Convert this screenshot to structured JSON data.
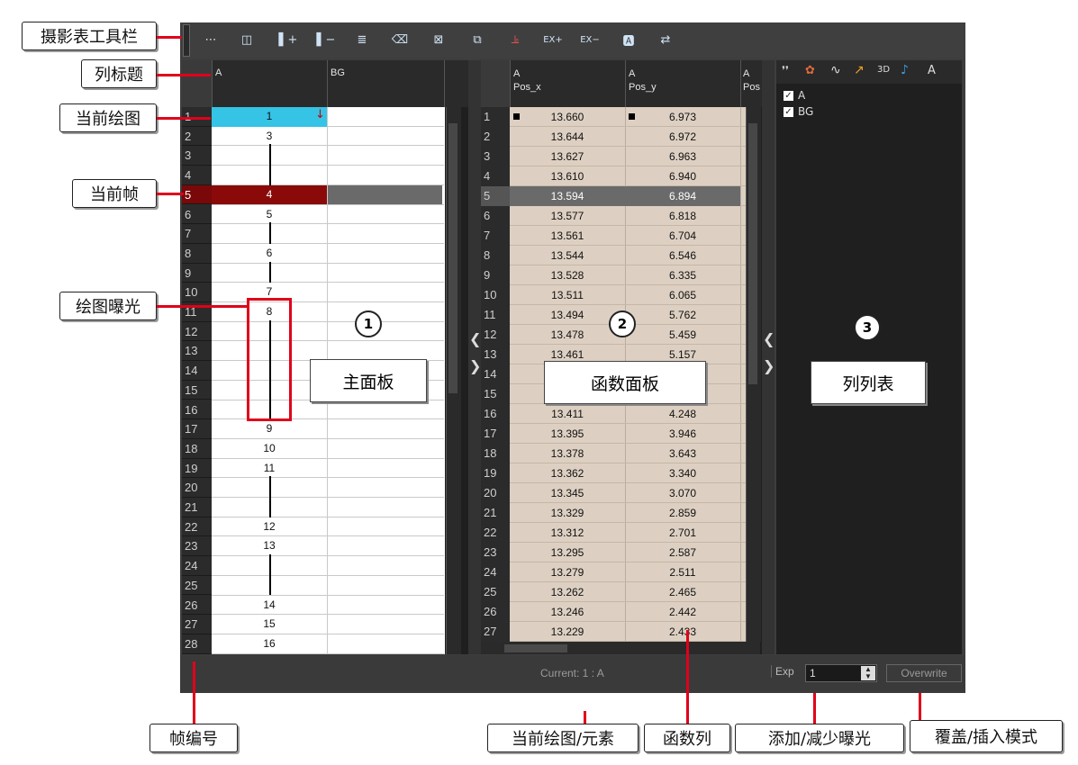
{
  "callouts": {
    "toolbar": "摄影表工具栏",
    "column_header": "列标题",
    "current_drawing": "当前绘图",
    "current_frame": "当前帧",
    "drawing_exposure": "绘图曝光",
    "frame_number": "帧编号",
    "current_drawing_element": "当前绘图/元素",
    "function_column": "函数列",
    "add_reduce_exposure": "添加/减少曝光",
    "overwrite_insert_mode": "覆盖/插入模式"
  },
  "panels": {
    "main": {
      "label": "主面板",
      "number": "1"
    },
    "function": {
      "label": "函数面板",
      "number": "2"
    },
    "column_list": {
      "label": "列列表",
      "number": "3"
    }
  },
  "xsheet": {
    "columns": [
      "A",
      "BG"
    ],
    "rows": [
      "1",
      "2",
      "3",
      "4",
      "5",
      "6",
      "7",
      "8",
      "9",
      "10",
      "11",
      "12",
      "13",
      "14",
      "15",
      "16",
      "17",
      "18",
      "19",
      "20",
      "21",
      "22",
      "23",
      "24",
      "25",
      "26",
      "27",
      "28"
    ],
    "col_a_values": [
      "1",
      "3",
      "",
      "",
      "4",
      "5",
      "",
      "6",
      "",
      "7",
      "8",
      "",
      "",
      "",
      "",
      "",
      "9",
      "10",
      "11",
      "",
      "",
      "12",
      "13",
      "",
      "",
      "14",
      "15",
      "16"
    ],
    "current_row": 1,
    "selected_frame": 5
  },
  "function_panel": {
    "headers": [
      {
        "element": "A",
        "param": "Pos_x"
      },
      {
        "element": "A",
        "param": "Pos_y"
      },
      {
        "element": "A",
        "param": "Pos"
      }
    ],
    "pos_x": [
      "13.660",
      "13.644",
      "13.627",
      "13.610",
      "13.594",
      "13.577",
      "13.561",
      "13.544",
      "13.528",
      "13.511",
      "13.494",
      "13.478",
      "13.461",
      "",
      "",
      "13.411",
      "13.395",
      "13.378",
      "13.362",
      "13.345",
      "13.329",
      "13.312",
      "13.295",
      "13.279",
      "13.262",
      "13.246",
      "13.229"
    ],
    "pos_y": [
      "6.973",
      "6.972",
      "6.963",
      "6.940",
      "6.894",
      "6.818",
      "6.704",
      "6.546",
      "6.335",
      "6.065",
      "5.762",
      "5.459",
      "5.157",
      "",
      "",
      "4.248",
      "3.946",
      "3.643",
      "3.340",
      "3.070",
      "2.859",
      "2.701",
      "2.587",
      "2.511",
      "2.465",
      "2.442",
      "2.433"
    ],
    "row_count": 27
  },
  "column_list": {
    "tabs": [
      "❜❜",
      "✿",
      "∿",
      "↗",
      "3D",
      "♪",
      "A"
    ],
    "items": [
      {
        "label": "A",
        "checked": true
      },
      {
        "label": "BG",
        "checked": true
      }
    ]
  },
  "status": {
    "current": "Current: 1 : A",
    "exp_label": "Exp",
    "exp_value": "1",
    "overwrite": "Overwrite"
  },
  "colors": {
    "current_drawing": "#35c3e6",
    "current_frame": "#8a0a0a",
    "function_cell": "#ddd0c2",
    "callout_line": "#e0001a"
  }
}
